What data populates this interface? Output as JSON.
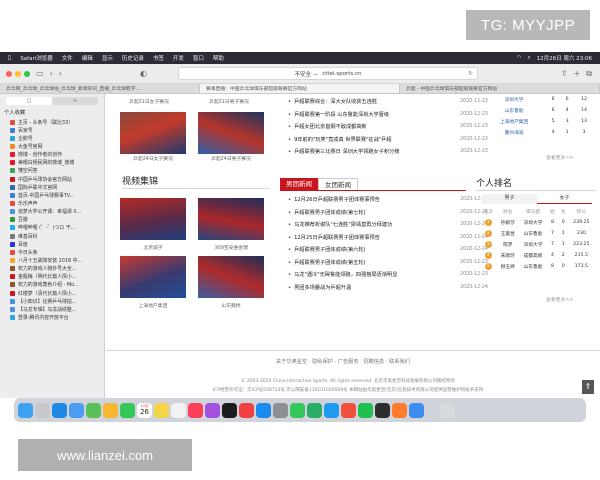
{
  "watermark_top": "TG: MYYJPP",
  "watermark_bottom": "www.lianzei.com",
  "menubar": {
    "apple": "",
    "items": [
      "Safari浏览器",
      "文件",
      "编辑",
      "显示",
      "历史记录",
      "书签",
      "开发",
      "窗口",
      "帮助"
    ],
    "clock": "12月26日 周六 23:06"
  },
  "address": {
    "security": "不安全 —",
    "url": "cttei.sports.cn"
  },
  "tabs": [
    {
      "label": "乒乓网_乒乓球_乒乓球拍_乒乓球_新闻资讯_直播_乒乓球教学..."
    },
    {
      "label": "赛事直播：中国乒乓球俱乐部超级联赛官方网站"
    },
    {
      "label": "乒超 - 中国乒乓球俱乐部超级联赛官方网站"
    }
  ],
  "sidebar": {
    "tab_bookmarks": "□",
    "tab_reading": "∞",
    "section_title": "个人收藏",
    "items": [
      {
        "label": "主页 - 头条号（联比33）",
        "color": "#e64b3c"
      },
      {
        "label": "百家号",
        "color": "#3b7de0"
      },
      {
        "label": "企鹅号",
        "color": "#2aa8e0"
      },
      {
        "label": "大鱼号官网",
        "color": "#f08a24"
      },
      {
        "label": "微博 - 创作者的创作",
        "color": "#e6162d"
      },
      {
        "label": "美眼白杨民网的微博_微博",
        "color": "#e6162d"
      },
      {
        "label": "懂空问答",
        "color": "#3aa55a"
      },
      {
        "label": "中国乒乓球协会官方网站",
        "color": "#c9161e"
      },
      {
        "label": "国际乒联中文官网",
        "color": "#2b6cb0"
      },
      {
        "label": "首页-中国乒乓球赛事TV...",
        "color": "#3b7de0"
      },
      {
        "label": "乐乐声声",
        "color": "#e64b3c"
      },
      {
        "label": "追梦大学公开课：幸福课 0...",
        "color": "#4a90e2"
      },
      {
        "label": "豆瓣",
        "color": "#2e963d"
      },
      {
        "label": "哔哩哔哩 (゜-゜)つロ 干...",
        "color": "#23ade5"
      },
      {
        "label": "维基百科",
        "color": "#777777"
      },
      {
        "label": "百度",
        "color": "#2932e1"
      },
      {
        "label": "今日头条",
        "color": "#e64b3c"
      },
      {
        "label": "八月十五故障安装 2018 中...",
        "color": "#f5a623"
      },
      {
        "label": "权力的游戏人物外号大全...",
        "color": "#8b572a"
      },
      {
        "label": "金瓶梅（明代长篇人情小...",
        "color": "#c9161e"
      },
      {
        "label": "权力的游戏角色介绍 - Mo...",
        "color": "#8b572a"
      },
      {
        "label": "红楼梦（清代长篇人情小...",
        "color": "#c9161e"
      },
      {
        "label": "【小知识】比赛乒乓球拍...",
        "color": "#4a90e2"
      },
      {
        "label": "【马龙专辑】马龙战绩整...",
        "color": "#4a90e2"
      },
      {
        "label": "登录-腾讯内容开放平台",
        "color": "#2aa8e0"
      }
    ]
  },
  "content": {
    "photo_captions_top": [
      "乒超21日女子赛况",
      "乒超21日男子赛况"
    ],
    "photo_captions_mid": [
      "乒超24日女子赛况",
      "乒超24日男子赛况"
    ],
    "video_title": "视频集锦",
    "video_captions": [
      "北京城子",
      "深圳宝安维金瑞",
      "上海地产集团",
      "山东魏桥"
    ],
    "news_top": [
      {
        "title": "乒超联赛综合：深大女队收获五连胜",
        "date": "2020-12-23"
      },
      {
        "title": "乒超联赛第一阶段 山东鲁能深圳大学晋级",
        "date": "2020-12-23"
      },
      {
        "title": "乒超女团北京首钢不敌成都高新",
        "date": "2020-12-23"
      },
      {
        "title": "9年前的\"玩笑\"竟成真 世界联赛\"征战\"乒超",
        "date": "2020-12-23"
      },
      {
        "title": "乒超联赛第三比赛日 深圳大学领跑女子积分榜",
        "date": "2020-12-23"
      }
    ],
    "news_tabs": {
      "active": "男团新闻",
      "inactive": "女团新闻"
    },
    "news_bottom": [
      {
        "title": "12月26日乒超联赛男子团体赛事预告",
        "date": "2020-12-25"
      },
      {
        "title": "乒超联赛男子团体成绩(第七轮)",
        "date": "2020-12-24"
      },
      {
        "title": "马龙推荐析谢队\"七连胜\"梁靖崑再分拜建功",
        "date": "2020-12-24"
      },
      {
        "title": "12月25日乒超联赛男子团体赛事预告",
        "date": "2020-12-24"
      },
      {
        "title": "乒超联赛男子团体成绩(第六轮)",
        "date": "2020-12-24"
      },
      {
        "title": "乒超联赛男子团体成绩(第五轮)",
        "date": "2020-12-23"
      },
      {
        "title": "马龙\"遇冷\"无碍鲁能领跑，四强格局逐渐明显",
        "date": "2020-12-23"
      },
      {
        "title": "男团多场鏖战为乒超升温",
        "date": "2020-12-24"
      }
    ],
    "team_table": [
      {
        "team": "深圳大学",
        "a": "6",
        "b": "6",
        "c": "12"
      },
      {
        "team": "山东鲁能",
        "a": "6",
        "b": "4",
        "c": "14"
      },
      {
        "team": "上海地产集团",
        "a": "5",
        "b": "3",
        "c": "13"
      },
      {
        "team": "衢州海润",
        "a": "4",
        "b": "1",
        "c": "3"
      }
    ],
    "more_label": "查看更多>>",
    "ranking_title": "个人排名",
    "ranking_tabs": {
      "male": "男子",
      "female": "女子"
    },
    "ranking_headers": [
      "名次",
      "姓名",
      "俱乐部",
      "胜",
      "负",
      "积分"
    ],
    "ranking_rows": [
      {
        "rank": "1",
        "name": "孙颖莎",
        "club": "深圳大学",
        "w": "8",
        "l": "0",
        "pts": "239.25",
        "color": "#f0a030"
      },
      {
        "rank": "2",
        "name": "王曼昱",
        "club": "山东鲁能",
        "w": "7",
        "l": "1",
        "pts": "230",
        "color": "#f0a030"
      },
      {
        "rank": "3",
        "name": "陈梦",
        "club": "深圳大学",
        "w": "7",
        "l": "1",
        "pts": "223.25",
        "color": "#f0a030"
      },
      {
        "rank": "4",
        "name": "朱雨玲",
        "club": "成都高新",
        "w": "4",
        "l": "2",
        "pts": "215.5",
        "color": "#f0a030"
      },
      {
        "rank": "5",
        "name": "顾玉婷",
        "club": "山东鲁能",
        "w": "8",
        "l": "0",
        "pts": "173.5",
        "color": "#f0a030"
      }
    ],
    "footer_nav": "关于华奥星空 · 隐私保护 · 广告服务 · 招聘信息 · 联系我们",
    "footer_copy": "© 2003-2020 China Interactive Sports. All rights reserved. 北京华奥星空科技发展有限公司版权所有",
    "footer_icp": "ICP经营许可证：京ICP证030713号  京公网安备110101020009号  本网站由华奥星空(北京)信息技术有限公司提供运营维护和技术支持"
  },
  "dock": {
    "calendar_month": "12月",
    "calendar_day": "26"
  }
}
